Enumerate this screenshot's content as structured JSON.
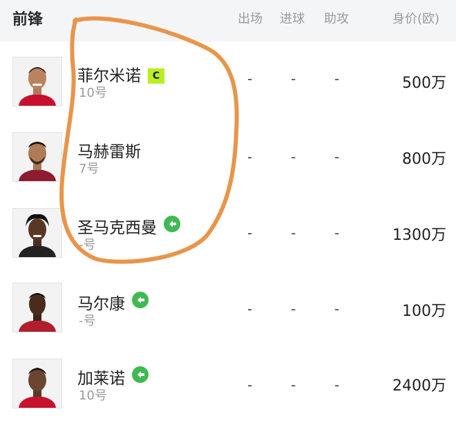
{
  "header": {
    "title": "前锋",
    "col_apps": "出场",
    "col_goals": "进球",
    "col_assists": "助攻",
    "col_value": "身价(欧)"
  },
  "players": [
    {
      "name": "菲尔米诺",
      "number": "10号",
      "badge": "captain",
      "badge_text": "C",
      "apps": "-",
      "goals": "-",
      "assists": "-",
      "value": "500万",
      "jersey_color": "#c8102e"
    },
    {
      "name": "马赫雷斯",
      "number": "7号",
      "badge": "",
      "apps": "-",
      "goals": "-",
      "assists": "-",
      "value": "800万",
      "jersey_color": "#8e1b2f"
    },
    {
      "name": "圣马克西曼",
      "number": "-号",
      "badge": "substitute",
      "apps": "-",
      "goals": "-",
      "assists": "-",
      "value": "1300万",
      "jersey_color": "#222222"
    },
    {
      "name": "马尔康",
      "number": "-号",
      "badge": "substitute",
      "apps": "-",
      "goals": "-",
      "assists": "-",
      "value": "100万",
      "jersey_color": "#b01e2c"
    },
    {
      "name": "加莱诺",
      "number": "10号",
      "badge": "substitute",
      "apps": "-",
      "goals": "-",
      "assists": "-",
      "value": "2400万",
      "jersey_color": "#c8102e"
    }
  ],
  "colors": {
    "captain_badge": "#b7ef1f",
    "substitute_badge": "#3fb950",
    "annotation_stroke": "#e8954a",
    "header_bg": "#f4f5f7"
  }
}
